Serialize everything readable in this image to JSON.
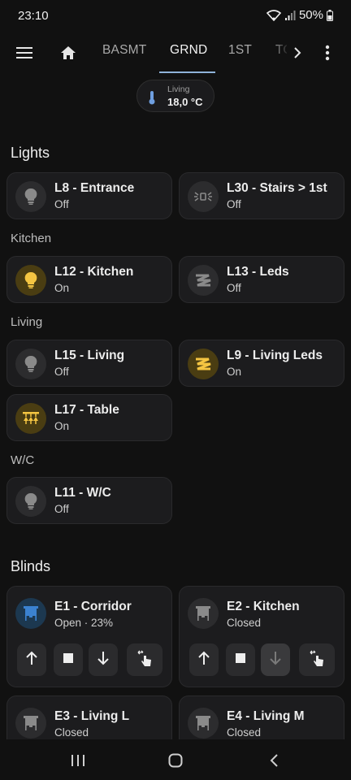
{
  "status": {
    "time": "23:10",
    "battery": "50%"
  },
  "nav": {
    "tabs": [
      {
        "label": "BASMT"
      },
      {
        "label": "GRND"
      },
      {
        "label": "1ST"
      },
      {
        "label": "TO"
      }
    ]
  },
  "temp": {
    "label": "Living",
    "value": "18,0 °C"
  },
  "sections": {
    "lights": "Lights",
    "kitchen": "Kitchen",
    "living": "Living",
    "wc": "W/C",
    "blinds": "Blinds"
  },
  "lights": [
    {
      "name": "L8 - Entrance",
      "state": "Off",
      "icon": "bulb-icon",
      "on": false
    },
    {
      "name": "L30 - Stairs > 1st",
      "state": "Off",
      "icon": "wall-light-icon",
      "on": false
    },
    {
      "name": "L12 - Kitchen",
      "state": "On",
      "icon": "bulb-icon",
      "on": true
    },
    {
      "name": "L13 - Leds",
      "state": "Off",
      "icon": "led-strip-icon",
      "on": false
    },
    {
      "name": "L15 - Living",
      "state": "Off",
      "icon": "bulb-icon",
      "on": false
    },
    {
      "name": "L9 - Living Leds",
      "state": "On",
      "icon": "led-strip-icon",
      "on": true
    },
    {
      "name": "L17 - Table",
      "state": "On",
      "icon": "ceiling-light-icon",
      "on": true
    },
    {
      "name": "L11 - W/C",
      "state": "Off",
      "icon": "bulb-icon",
      "on": false
    }
  ],
  "blinds": [
    {
      "name": "E1 - Corridor",
      "state": "Open · 23%",
      "icon": "blind-icon",
      "position_percent": 23
    },
    {
      "name": "E2 - Kitchen",
      "state": "Closed",
      "icon": "blind-icon"
    },
    {
      "name": "E3 - Living L",
      "state": "Closed",
      "icon": "blind-icon"
    },
    {
      "name": "E4 - Living M",
      "state": "Closed",
      "icon": "blind-icon"
    }
  ],
  "colors": {
    "accent": "#8fb2d8",
    "on": "#f4c542",
    "blind_open": "#3b82d0",
    "background": "#111111",
    "card": "#1c1c1e"
  }
}
